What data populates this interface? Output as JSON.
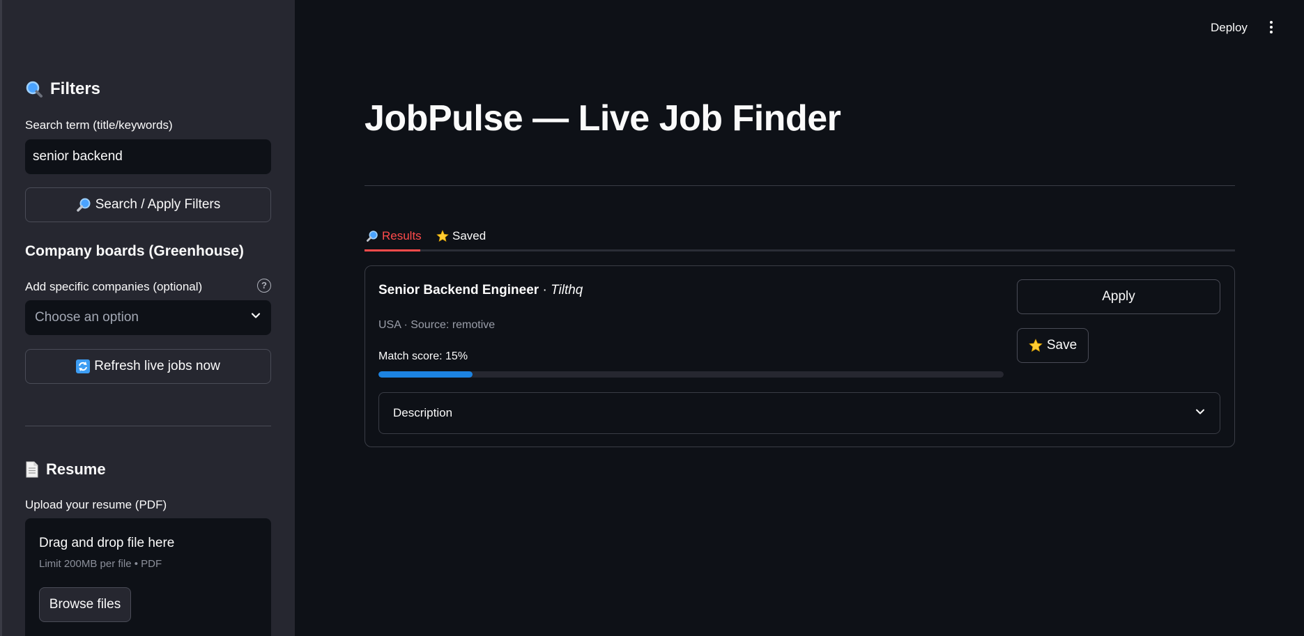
{
  "sidebar": {
    "filters_heading": "Filters",
    "search_label": "Search term (title/keywords)",
    "search_value": "senior backend",
    "search_button": "Search / Apply Filters",
    "company_boards_heading": "Company boards (Greenhouse)",
    "companies_label": "Add specific companies (optional)",
    "companies_placeholder": "Choose an option",
    "refresh_button": "Refresh live jobs now",
    "resume_heading": "Resume",
    "upload_label": "Upload your resume (PDF)",
    "upload_title": "Drag and drop file here",
    "upload_limit": "Limit 200MB per file • PDF",
    "browse_button": "Browse files"
  },
  "header": {
    "deploy_label": "Deploy"
  },
  "main": {
    "title": "JobPulse — Live Job Finder",
    "tabs": [
      {
        "label": "Results",
        "icon": "magnifier-icon",
        "active": true
      },
      {
        "label": "Saved",
        "icon": "star-icon",
        "active": false
      }
    ]
  },
  "job": {
    "title": "Senior Backend Engineer",
    "separator": "·",
    "company": "Tilthq",
    "meta": "USA · Source: remotive",
    "match_label": "Match score: 15%",
    "match_score": 0.15,
    "apply_label": "Apply",
    "save_label": "Save",
    "description_label": "Description"
  },
  "colors": {
    "background": "#0e1117",
    "sidebar": "#262730",
    "accent_red": "#ff4b4b",
    "progress_blue": "#1c83e1"
  }
}
